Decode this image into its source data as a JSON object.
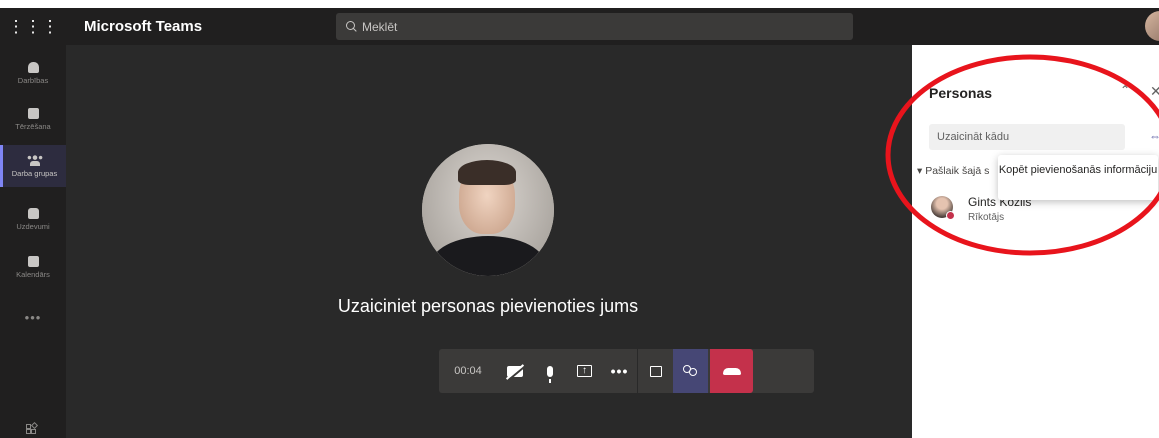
{
  "topbar": {
    "app_name": "Microsoft Teams",
    "search_placeholder": "Meklēt"
  },
  "rail": {
    "items": [
      {
        "label": "Darbības",
        "icon": "bell-icon"
      },
      {
        "label": "Tērzēšana",
        "icon": "chat-icon"
      },
      {
        "label": "Darba grupas",
        "icon": "teams-icon",
        "active": true
      },
      {
        "label": "Uzdevumi",
        "icon": "assignments-icon"
      },
      {
        "label": "Kalendārs",
        "icon": "calendar-icon"
      }
    ],
    "more": "•••"
  },
  "meeting": {
    "invite_text": "Uzaiciniet personas pievienoties jums",
    "timer": "00:04"
  },
  "controls": {
    "camera": "camera-off-icon",
    "mic": "microphone-icon",
    "share": "share-screen-icon",
    "more": "more-options-icon",
    "chat": "conversation-icon",
    "participants": "participants-icon",
    "hangup": "hang-up-icon"
  },
  "panel": {
    "title": "Personas",
    "invite_placeholder": "Uzaicināt kādu",
    "section_label": "Pašlaik šajā s",
    "tooltip": "Kopēt pievienošanās informāciju",
    "participant": {
      "name": "Gints Kozlis",
      "role": "Rīkotājs"
    }
  },
  "colors": {
    "topbar_bg": "#201f1f",
    "stage_bg": "#292929",
    "accent": "#6264a7",
    "hangup": "#c4314b",
    "annotation": "#e8141c"
  }
}
